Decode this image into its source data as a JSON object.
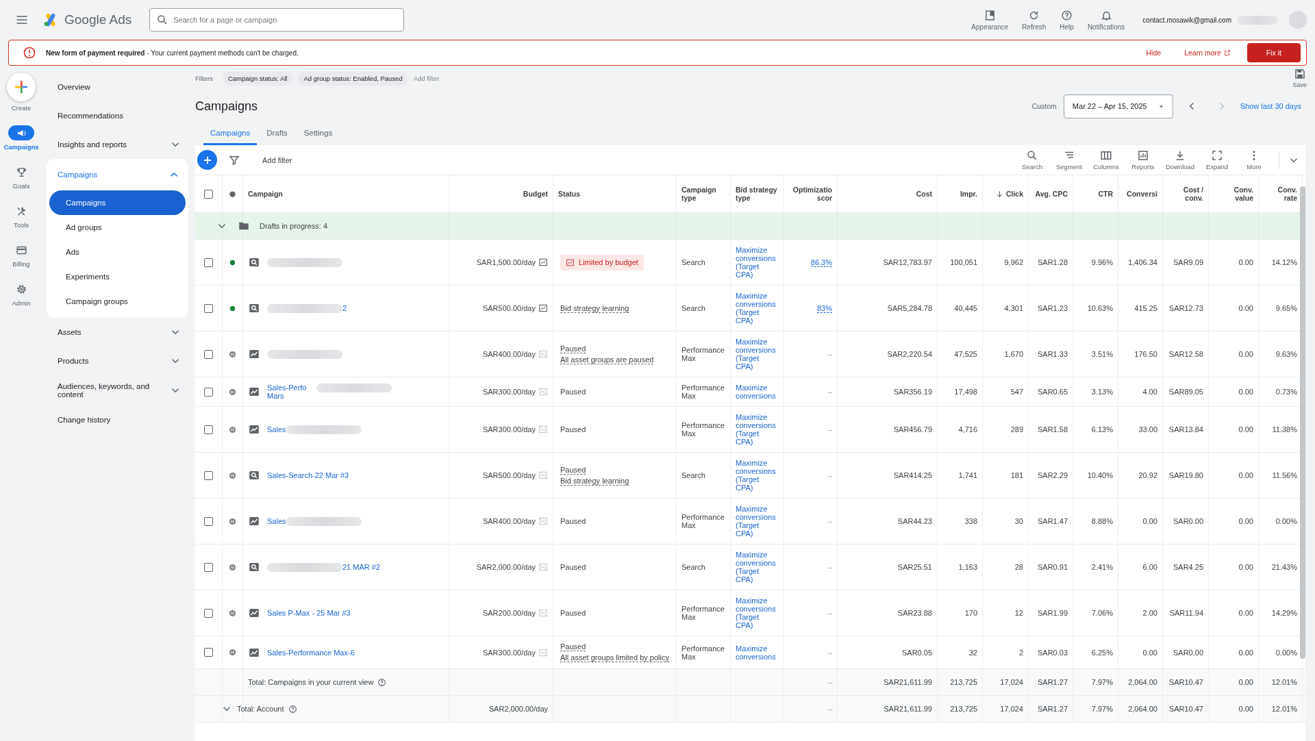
{
  "app": {
    "name": "Google Ads"
  },
  "search": {
    "placeholder": "Search for a page or campaign"
  },
  "top_actions": [
    {
      "label": "Appearance",
      "kind": "appearance"
    },
    {
      "label": "Refresh",
      "kind": "refresh"
    },
    {
      "label": "Help",
      "kind": "help"
    },
    {
      "label": "Notifications",
      "kind": "bell"
    }
  ],
  "account": {
    "email": "contact.mosawik@gmail.com"
  },
  "banner": {
    "message": "**New form of payment required** - Your current payment methods can't be charged.",
    "hide": "Hide",
    "learn_more": "Learn more",
    "fix": "Fix it"
  },
  "create": {
    "label": "Create"
  },
  "rail": [
    {
      "label": "Campaigns",
      "kind": "megaphone",
      "selected": true
    },
    {
      "label": "Goals",
      "kind": "trophy",
      "selected": false
    },
    {
      "label": "Tools",
      "kind": "tools",
      "selected": false
    },
    {
      "label": "Billing",
      "kind": "card",
      "selected": false
    },
    {
      "label": "Admin",
      "kind": "gear",
      "selected": false
    }
  ],
  "nav": [
    {
      "label": "Overview",
      "expandable": false
    },
    {
      "label": "Recommendations",
      "expandable": false
    },
    {
      "label": "Insights and reports",
      "expandable": true,
      "expanded": false
    },
    {
      "label": "Campaigns",
      "expandable": true,
      "expanded": true,
      "children": [
        {
          "label": "Campaigns",
          "selected": true
        },
        {
          "label": "Ad groups",
          "selected": false
        },
        {
          "label": "Ads",
          "selected": false
        },
        {
          "label": "Experiments",
          "selected": false
        },
        {
          "label": "Campaign groups",
          "selected": false
        }
      ]
    },
    {
      "label": "Assets",
      "expandable": true,
      "expanded": false
    },
    {
      "label": "Products",
      "expandable": true,
      "expanded": false
    },
    {
      "label": "Audiences, keywords, and content",
      "expandable": true,
      "expanded": false
    },
    {
      "label": "Change history",
      "expandable": false
    }
  ],
  "filters": {
    "label": "Filters",
    "chips": [
      "Campaign status: All",
      "Ad group status: Enabled, Paused"
    ],
    "add": "Add filter",
    "save": "Save"
  },
  "page_title": "Campaigns",
  "date": {
    "label": "Custom",
    "range": "Mar 22 – Apr 15, 2025",
    "shortcut": "Show last 30 days"
  },
  "tabs": [
    {
      "label": "Campaigns",
      "selected": true
    },
    {
      "label": "Drafts",
      "selected": false
    },
    {
      "label": "Settings",
      "selected": false
    }
  ],
  "toolbar": {
    "add_filter": "Add filter",
    "tools": [
      {
        "label": "Search",
        "kind": "search"
      },
      {
        "label": "Segment",
        "kind": "segment"
      },
      {
        "label": "Columns",
        "kind": "columns"
      },
      {
        "label": "Reports",
        "kind": "reports"
      },
      {
        "label": "Download",
        "kind": "download"
      },
      {
        "label": "Expand",
        "kind": "expand"
      },
      {
        "label": "More",
        "kind": "more"
      }
    ]
  },
  "table": {
    "select_all_checked": false,
    "columns": [
      {
        "label": "Campaign",
        "kind": "text",
        "sorted": false
      },
      {
        "label": "Budget",
        "kind": "number",
        "sorted": false
      },
      {
        "label": "Status",
        "kind": "text",
        "sorted": false
      },
      {
        "label": "Campaign type",
        "kind": "text",
        "sorted": false
      },
      {
        "label": "Bid strategy type",
        "kind": "text",
        "sorted": false
      },
      {
        "label": "Optimizatio scor",
        "kind": "number",
        "sorted": false
      },
      {
        "label": "Cost",
        "kind": "number",
        "sorted": false
      },
      {
        "label": "Impr.",
        "kind": "number",
        "sorted": false
      },
      {
        "label": "Click",
        "kind": "number",
        "sorted": true
      },
      {
        "label": "Avg. CPC",
        "kind": "number",
        "sorted": false
      },
      {
        "label": "CTR",
        "kind": "number",
        "sorted": false
      },
      {
        "label": "Conversi",
        "kind": "number",
        "sorted": false
      },
      {
        "label": "Cost / conv.",
        "kind": "number",
        "sorted": false
      },
      {
        "label": "Conv. value",
        "kind": "number",
        "sorted": false
      },
      {
        "label": "Conv. rate",
        "kind": "number",
        "sorted": false
      }
    ],
    "drafts": {
      "label": "Drafts in progress: 4"
    },
    "rows": [
      {
        "checked": false,
        "enabled": true,
        "name": "",
        "budget": "SAR1,500.00/day",
        "status": [
          {
            "text": "Limited by budget",
            "kind": "alert"
          }
        ],
        "type": "Search",
        "bid": "Maximize conversions (Target CPA)",
        "score": "86.3%",
        "metrics": [
          "SAR12,783.97",
          "100,051",
          "9,962",
          "SAR1.28",
          "9.96%",
          "1,406.34",
          "SAR9.09",
          "0.00",
          "14.12%"
        ],
        "blur_before": true,
        "blur_after": false,
        "budget_graph_active": true,
        "score_linked": true,
        "kind": "search"
      },
      {
        "checked": false,
        "enabled": true,
        "name": "2",
        "budget": "SAR500.00/day",
        "status": [
          {
            "text": "Bid strategy learning",
            "kind": "dotted"
          }
        ],
        "type": "Search",
        "bid": "Maximize conversions (Target CPA)",
        "score": "83%",
        "metrics": [
          "SAR5,284.78",
          "40,445",
          "4,301",
          "SAR1.23",
          "10.63%",
          "415.25",
          "SAR12.73",
          "0.00",
          "9.65%"
        ],
        "blur_before": true,
        "blur_after": false,
        "budget_graph_active": true,
        "score_linked": true,
        "kind": "search"
      },
      {
        "checked": false,
        "enabled": false,
        "name": "",
        "budget": "SAR400.00/day",
        "status": [
          {
            "text": "Paused",
            "kind": "dotted"
          },
          {
            "text": "All asset groups are paused",
            "kind": "dotted"
          }
        ],
        "type": "Performance Max",
        "bid": "Maximize conversions (Target CPA)",
        "score": "–",
        "metrics": [
          "SAR2,220.54",
          "47,525",
          "1,670",
          "SAR1.33",
          "3.51%",
          "176.50",
          "SAR12.58",
          "0.00",
          "9.63%"
        ],
        "blur_before": true,
        "blur_after": false,
        "budget_graph_active": false,
        "score_linked": false,
        "kind": "pmax"
      },
      {
        "checked": false,
        "enabled": false,
        "name": "Sales-Perfo Mars",
        "budget": "SAR300.00/day",
        "status": [
          {
            "text": "Paused",
            "kind": "plain"
          }
        ],
        "type": "Performance Max",
        "bid": "Maximize conversions",
        "score": "–",
        "metrics": [
          "SAR356.19",
          "17,498",
          "547",
          "SAR0.65",
          "3.13%",
          "4.00",
          "SAR89.05",
          "0.00",
          "0.73%"
        ],
        "blur_before": false,
        "blur_after": true,
        "budget_graph_active": false,
        "score_linked": false,
        "kind": "pmax"
      },
      {
        "checked": false,
        "enabled": false,
        "name": "Sales",
        "budget": "SAR300.00/day",
        "status": [
          {
            "text": "Paused",
            "kind": "plain"
          }
        ],
        "type": "Performance Max",
        "bid": "Maximize conversions (Target CPA)",
        "score": "–",
        "metrics": [
          "SAR456.79",
          "4,716",
          "289",
          "SAR1.58",
          "6.13%",
          "33.00",
          "SAR13.84",
          "0.00",
          "11.38%"
        ],
        "blur_before": false,
        "blur_after": true,
        "budget_graph_active": false,
        "score_linked": false,
        "kind": "pmax"
      },
      {
        "checked": false,
        "enabled": false,
        "name": "Sales-Search-22 Mar #3",
        "budget": "SAR500.00/day",
        "status": [
          {
            "text": "Paused",
            "kind": "dotted"
          },
          {
            "text": "Bid strategy learning",
            "kind": "dotted"
          }
        ],
        "type": "Search",
        "bid": "Maximize conversions (Target CPA)",
        "score": "–",
        "metrics": [
          "SAR414.25",
          "1,741",
          "181",
          "SAR2.29",
          "10.40%",
          "20.92",
          "SAR19.80",
          "0.00",
          "11.56%"
        ],
        "blur_before": false,
        "blur_after": false,
        "budget_graph_active": false,
        "score_linked": false,
        "kind": "search"
      },
      {
        "checked": false,
        "enabled": false,
        "name": "Sales",
        "budget": "SAR400.00/day",
        "status": [
          {
            "text": "Paused",
            "kind": "plain"
          }
        ],
        "type": "Performance Max",
        "bid": "Maximize conversions (Target CPA)",
        "score": "–",
        "metrics": [
          "SAR44.23",
          "338",
          "30",
          "SAR1.47",
          "8.88%",
          "0.00",
          "SAR0.00",
          "0.00",
          "0.00%"
        ],
        "blur_before": false,
        "blur_after": true,
        "budget_graph_active": false,
        "score_linked": false,
        "kind": "pmax"
      },
      {
        "checked": false,
        "enabled": false,
        "name": "21 MAR #2",
        "budget": "SAR2,000.00/day",
        "status": [
          {
            "text": "Paused",
            "kind": "plain"
          }
        ],
        "type": "Search",
        "bid": "Maximize conversions (Target CPA)",
        "score": "–",
        "metrics": [
          "SAR25.51",
          "1,163",
          "28",
          "SAR0.91",
          "2.41%",
          "6.00",
          "SAR4.25",
          "0.00",
          "21.43%"
        ],
        "blur_before": true,
        "blur_after": false,
        "budget_graph_active": false,
        "score_linked": false,
        "kind": "search"
      },
      {
        "checked": false,
        "enabled": false,
        "name": "Sales P-Max - 25 Mar #3",
        "budget": "SAR200.00/day",
        "status": [
          {
            "text": "Paused",
            "kind": "plain"
          }
        ],
        "type": "Performance Max",
        "bid": "Maximize conversions (Target CPA)",
        "score": "–",
        "metrics": [
          "SAR23.88",
          "170",
          "12",
          "SAR1.99",
          "7.06%",
          "2.00",
          "SAR11.94",
          "0.00",
          "14.29%"
        ],
        "blur_before": false,
        "blur_after": false,
        "budget_graph_active": false,
        "score_linked": false,
        "kind": "pmax"
      },
      {
        "checked": false,
        "enabled": false,
        "name": "Sales-Performance Max-6",
        "budget": "SAR300.00/day",
        "status": [
          {
            "text": "Paused",
            "kind": "dotted"
          },
          {
            "text": "All asset groups limited by policy",
            "kind": "dotted"
          }
        ],
        "type": "Performance Max",
        "bid": "Maximize conversions",
        "score": "–",
        "metrics": [
          "SAR0.05",
          "32",
          "2",
          "SAR0.03",
          "6.25%",
          "0.00",
          "SAR0.00",
          "0.00",
          "0.00%"
        ],
        "blur_before": false,
        "blur_after": false,
        "budget_graph_active": false,
        "score_linked": false,
        "kind": "pmax"
      }
    ],
    "totals": [
      {
        "label": "Total: Campaigns in your current view",
        "expander": false,
        "score": "–",
        "metrics": [
          "SAR21,611.99",
          "213,725",
          "17,024",
          "SAR1.27",
          "7.97%",
          "2,064.00",
          "SAR10.47",
          "0.00",
          "12.01%"
        ]
      },
      {
        "label": "Total: Account",
        "expander": true,
        "budget": "SAR2,000.00/day",
        "score": "–",
        "metrics": [
          "SAR21,611.99",
          "213,725",
          "17,024",
          "SAR1.27",
          "7.97%",
          "2,064.00",
          "SAR10.47",
          "0.00",
          "12.01%"
        ]
      }
    ]
  }
}
